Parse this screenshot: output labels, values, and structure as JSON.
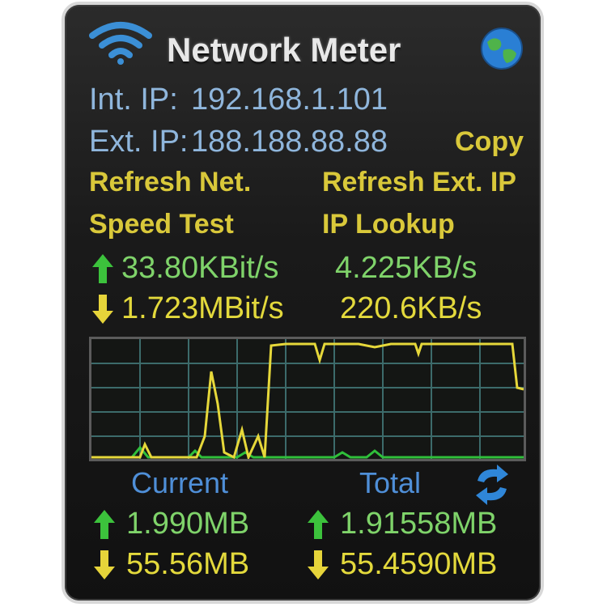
{
  "header": {
    "title": "Network Meter",
    "wifi_icon": "wifi-icon",
    "globe_icon": "globe-icon"
  },
  "ip": {
    "int_label": "Int. IP:",
    "int_value": "192.168.1.101",
    "ext_label": "Ext. IP:",
    "ext_value": "188.188.88.88",
    "copy_label": "Copy"
  },
  "actions": {
    "refresh_net": "Refresh Net.",
    "refresh_ext_ip": "Refresh Ext. IP",
    "speed_test": "Speed Test",
    "ip_lookup": "IP Lookup"
  },
  "speeds": {
    "up_bits": "33.80KBit/s",
    "up_bytes": "4.225KB/s",
    "down_bits": "1.723MBit/s",
    "down_bytes": "220.6KB/s"
  },
  "graph": {
    "upload_color": "#2fbf3a",
    "download_color": "#e6d83a",
    "grid_color": "#3c6b6b"
  },
  "totals": {
    "current_label": "Current",
    "total_label": "Total",
    "current_up": "1.990MB",
    "current_down": "55.56MB",
    "total_up": "1.91558MB",
    "total_down": "55.4590MB",
    "reset_icon": "refresh-arrows-icon"
  },
  "colors": {
    "up_arrow": "#3cc23c",
    "down_arrow": "#e6d43a",
    "accent_blue": "#4f8fd8"
  }
}
